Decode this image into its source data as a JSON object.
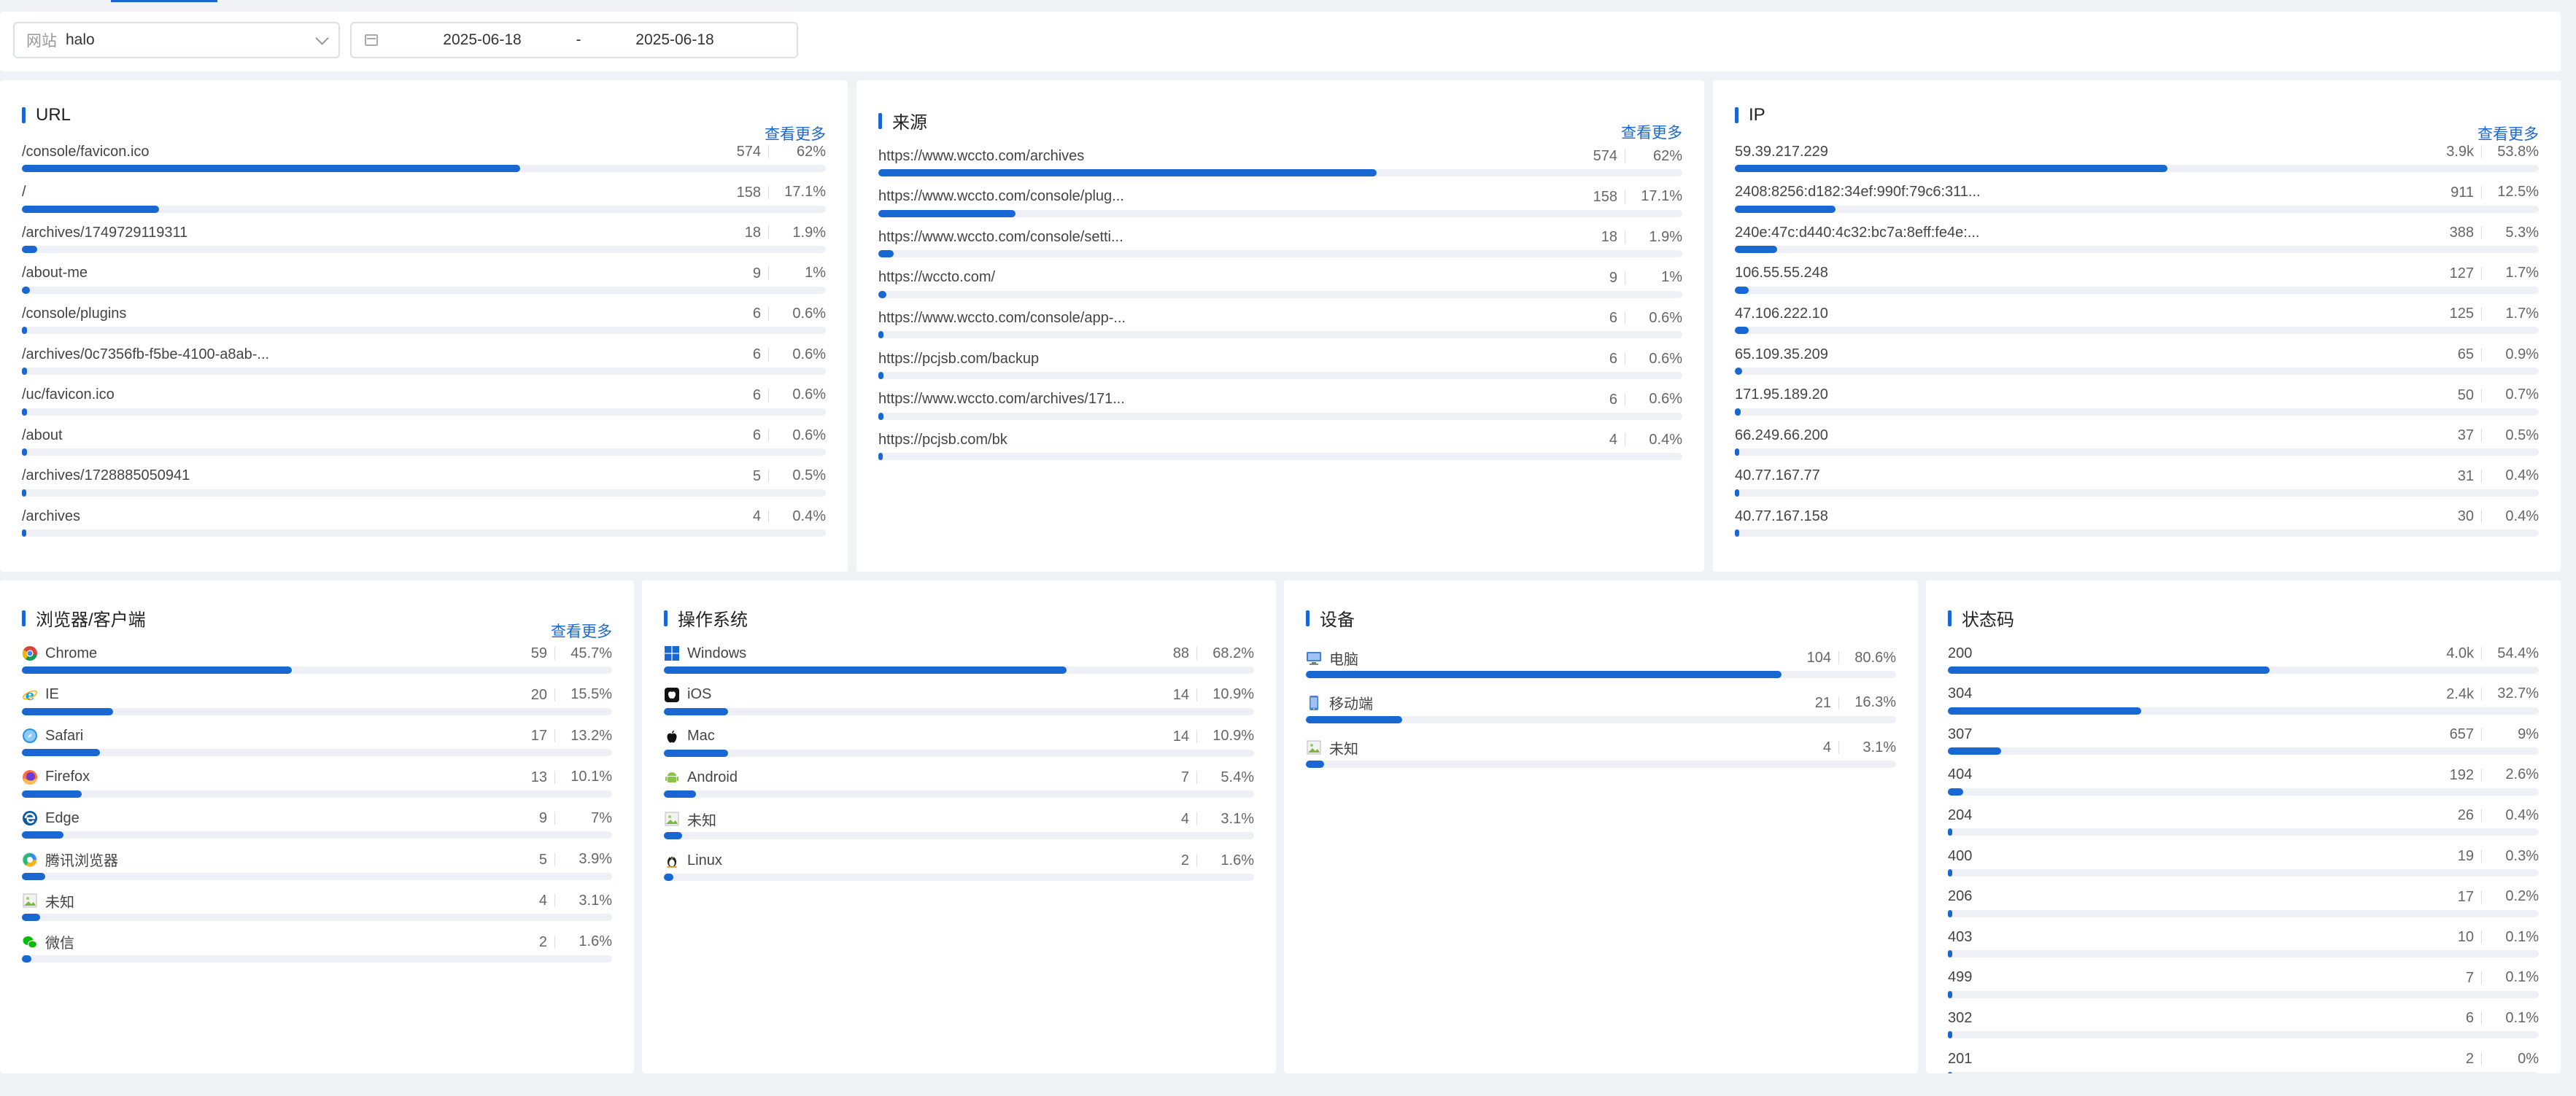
{
  "filter": {
    "site_label": "网站",
    "site_value": "halo",
    "date_start": "2025-06-18",
    "date_sep": "-",
    "date_end": "2025-06-18"
  },
  "colors": {
    "accent": "#1967d2",
    "track": "#eef0f5"
  },
  "cards": {
    "url": {
      "title": "URL",
      "more": "查看更多",
      "rows": [
        {
          "label": "/console/favicon.ico",
          "count": "574",
          "pct": "62%",
          "ratio": 0.62
        },
        {
          "label": "/",
          "count": "158",
          "pct": "17.1%",
          "ratio": 0.171
        },
        {
          "label": "/archives/1749729119311",
          "count": "18",
          "pct": "1.9%",
          "ratio": 0.019
        },
        {
          "label": "/about-me",
          "count": "9",
          "pct": "1%",
          "ratio": 0.01
        },
        {
          "label": "/console/plugins",
          "count": "6",
          "pct": "0.6%",
          "ratio": 0.006
        },
        {
          "label": "/archives/0c7356fb-f5be-4100-a8ab-...",
          "count": "6",
          "pct": "0.6%",
          "ratio": 0.006
        },
        {
          "label": "/uc/favicon.ico",
          "count": "6",
          "pct": "0.6%",
          "ratio": 0.006
        },
        {
          "label": "/about",
          "count": "6",
          "pct": "0.6%",
          "ratio": 0.006
        },
        {
          "label": "/archives/1728885050941",
          "count": "5",
          "pct": "0.5%",
          "ratio": 0.005
        },
        {
          "label": "/archives",
          "count": "4",
          "pct": "0.4%",
          "ratio": 0.004
        }
      ]
    },
    "source": {
      "title": "来源",
      "more": "查看更多",
      "rows": [
        {
          "label": "https://www.wccto.com/archives",
          "count": "574",
          "pct": "62%",
          "ratio": 0.62
        },
        {
          "label": "https://www.wccto.com/console/plug...",
          "count": "158",
          "pct": "17.1%",
          "ratio": 0.171
        },
        {
          "label": "https://www.wccto.com/console/setti...",
          "count": "18",
          "pct": "1.9%",
          "ratio": 0.019
        },
        {
          "label": "https://wccto.com/",
          "count": "9",
          "pct": "1%",
          "ratio": 0.01
        },
        {
          "label": "https://www.wccto.com/console/app-...",
          "count": "6",
          "pct": "0.6%",
          "ratio": 0.006
        },
        {
          "label": "https://pcjsb.com/backup",
          "count": "6",
          "pct": "0.6%",
          "ratio": 0.006
        },
        {
          "label": "https://www.wccto.com/archives/171...",
          "count": "6",
          "pct": "0.6%",
          "ratio": 0.006
        },
        {
          "label": "https://pcjsb.com/bk",
          "count": "4",
          "pct": "0.4%",
          "ratio": 0.004
        }
      ]
    },
    "ip": {
      "title": "IP",
      "more": "查看更多",
      "rows": [
        {
          "label": "59.39.217.229",
          "count": "3.9k",
          "pct": "53.8%",
          "ratio": 0.538
        },
        {
          "label": "2408:8256:d182:34ef:990f:79c6:311...",
          "count": "911",
          "pct": "12.5%",
          "ratio": 0.125
        },
        {
          "label": "240e:47c:d440:4c32:bc7a:8eff:fe4e:...",
          "count": "388",
          "pct": "5.3%",
          "ratio": 0.053
        },
        {
          "label": "106.55.55.248",
          "count": "127",
          "pct": "1.7%",
          "ratio": 0.017
        },
        {
          "label": "47.106.222.10",
          "count": "125",
          "pct": "1.7%",
          "ratio": 0.017
        },
        {
          "label": "65.109.35.209",
          "count": "65",
          "pct": "0.9%",
          "ratio": 0.009
        },
        {
          "label": "171.95.189.20",
          "count": "50",
          "pct": "0.7%",
          "ratio": 0.007
        },
        {
          "label": "66.249.66.200",
          "count": "37",
          "pct": "0.5%",
          "ratio": 0.005
        },
        {
          "label": "40.77.167.77",
          "count": "31",
          "pct": "0.4%",
          "ratio": 0.004
        },
        {
          "label": "40.77.167.158",
          "count": "30",
          "pct": "0.4%",
          "ratio": 0.004
        }
      ]
    },
    "browser": {
      "title": "浏览器/客户端",
      "more": "查看更多",
      "rows": [
        {
          "label": "Chrome",
          "icon": "chrome-icon",
          "count": "59",
          "pct": "45.7%",
          "ratio": 0.457
        },
        {
          "label": "IE",
          "icon": "ie-icon",
          "count": "20",
          "pct": "15.5%",
          "ratio": 0.155
        },
        {
          "label": "Safari",
          "icon": "safari-icon",
          "count": "17",
          "pct": "13.2%",
          "ratio": 0.132
        },
        {
          "label": "Firefox",
          "icon": "firefox-icon",
          "count": "13",
          "pct": "10.1%",
          "ratio": 0.101
        },
        {
          "label": "Edge",
          "icon": "edge-icon",
          "count": "9",
          "pct": "7%",
          "ratio": 0.07
        },
        {
          "label": "腾讯浏览器",
          "icon": "tencent-browser-icon",
          "count": "5",
          "pct": "3.9%",
          "ratio": 0.039
        },
        {
          "label": "未知",
          "icon": "unknown-image-icon",
          "count": "4",
          "pct": "3.1%",
          "ratio": 0.031
        },
        {
          "label": "微信",
          "icon": "wechat-icon",
          "count": "2",
          "pct": "1.6%",
          "ratio": 0.016
        }
      ]
    },
    "os": {
      "title": "操作系统",
      "rows": [
        {
          "label": "Windows",
          "icon": "windows-icon",
          "count": "88",
          "pct": "68.2%",
          "ratio": 0.682
        },
        {
          "label": "iOS",
          "icon": "ios-icon",
          "count": "14",
          "pct": "10.9%",
          "ratio": 0.109
        },
        {
          "label": "Mac",
          "icon": "apple-icon",
          "count": "14",
          "pct": "10.9%",
          "ratio": 0.109
        },
        {
          "label": "Android",
          "icon": "android-icon",
          "count": "7",
          "pct": "5.4%",
          "ratio": 0.054
        },
        {
          "label": "未知",
          "icon": "unknown-image-icon",
          "count": "4",
          "pct": "3.1%",
          "ratio": 0.031
        },
        {
          "label": "Linux",
          "icon": "linux-icon",
          "count": "2",
          "pct": "1.6%",
          "ratio": 0.016
        }
      ]
    },
    "device": {
      "title": "设备",
      "rows": [
        {
          "label": "电脑",
          "icon": "desktop-icon",
          "count": "104",
          "pct": "80.6%",
          "ratio": 0.806
        },
        {
          "label": "移动端",
          "icon": "mobile-icon",
          "count": "21",
          "pct": "16.3%",
          "ratio": 0.163
        },
        {
          "label": "未知",
          "icon": "unknown-image-icon",
          "count": "4",
          "pct": "3.1%",
          "ratio": 0.031
        }
      ]
    },
    "status": {
      "title": "状态码",
      "rows": [
        {
          "label": "200",
          "count": "4.0k",
          "pct": "54.4%",
          "ratio": 0.544
        },
        {
          "label": "304",
          "count": "2.4k",
          "pct": "32.7%",
          "ratio": 0.327
        },
        {
          "label": "307",
          "count": "657",
          "pct": "9%",
          "ratio": 0.09
        },
        {
          "label": "404",
          "count": "192",
          "pct": "2.6%",
          "ratio": 0.026
        },
        {
          "label": "204",
          "count": "26",
          "pct": "0.4%",
          "ratio": 0.004
        },
        {
          "label": "400",
          "count": "19",
          "pct": "0.3%",
          "ratio": 0.003
        },
        {
          "label": "206",
          "count": "17",
          "pct": "0.2%",
          "ratio": 0.002
        },
        {
          "label": "403",
          "count": "10",
          "pct": "0.1%",
          "ratio": 0.001
        },
        {
          "label": "499",
          "count": "7",
          "pct": "0.1%",
          "ratio": 0.001
        },
        {
          "label": "302",
          "count": "6",
          "pct": "0.1%",
          "ratio": 0.001
        },
        {
          "label": "201",
          "count": "2",
          "pct": "0%",
          "ratio": 0.0
        }
      ]
    }
  }
}
